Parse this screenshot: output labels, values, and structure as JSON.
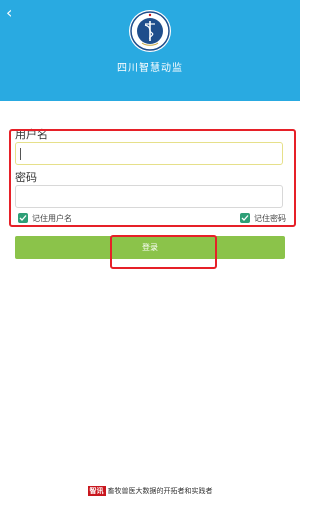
{
  "header": {
    "back_glyph": "‹",
    "app_title": "四川智慧动监",
    "logo_text": "全国动物卫生监督",
    "background_color": "#29aae1"
  },
  "form": {
    "username_label": "用户名",
    "username_value": "",
    "password_label": "密码",
    "password_value": "",
    "remember_username_label": "记住用户名",
    "remember_username_checked": true,
    "remember_password_label": "记住密码",
    "remember_password_checked": true,
    "login_label": "登录",
    "accent_color": "#8bc34a"
  },
  "footer": {
    "brand": "智讯",
    "tagline": "畜牧兽医大数据的开拓者和实践者"
  }
}
